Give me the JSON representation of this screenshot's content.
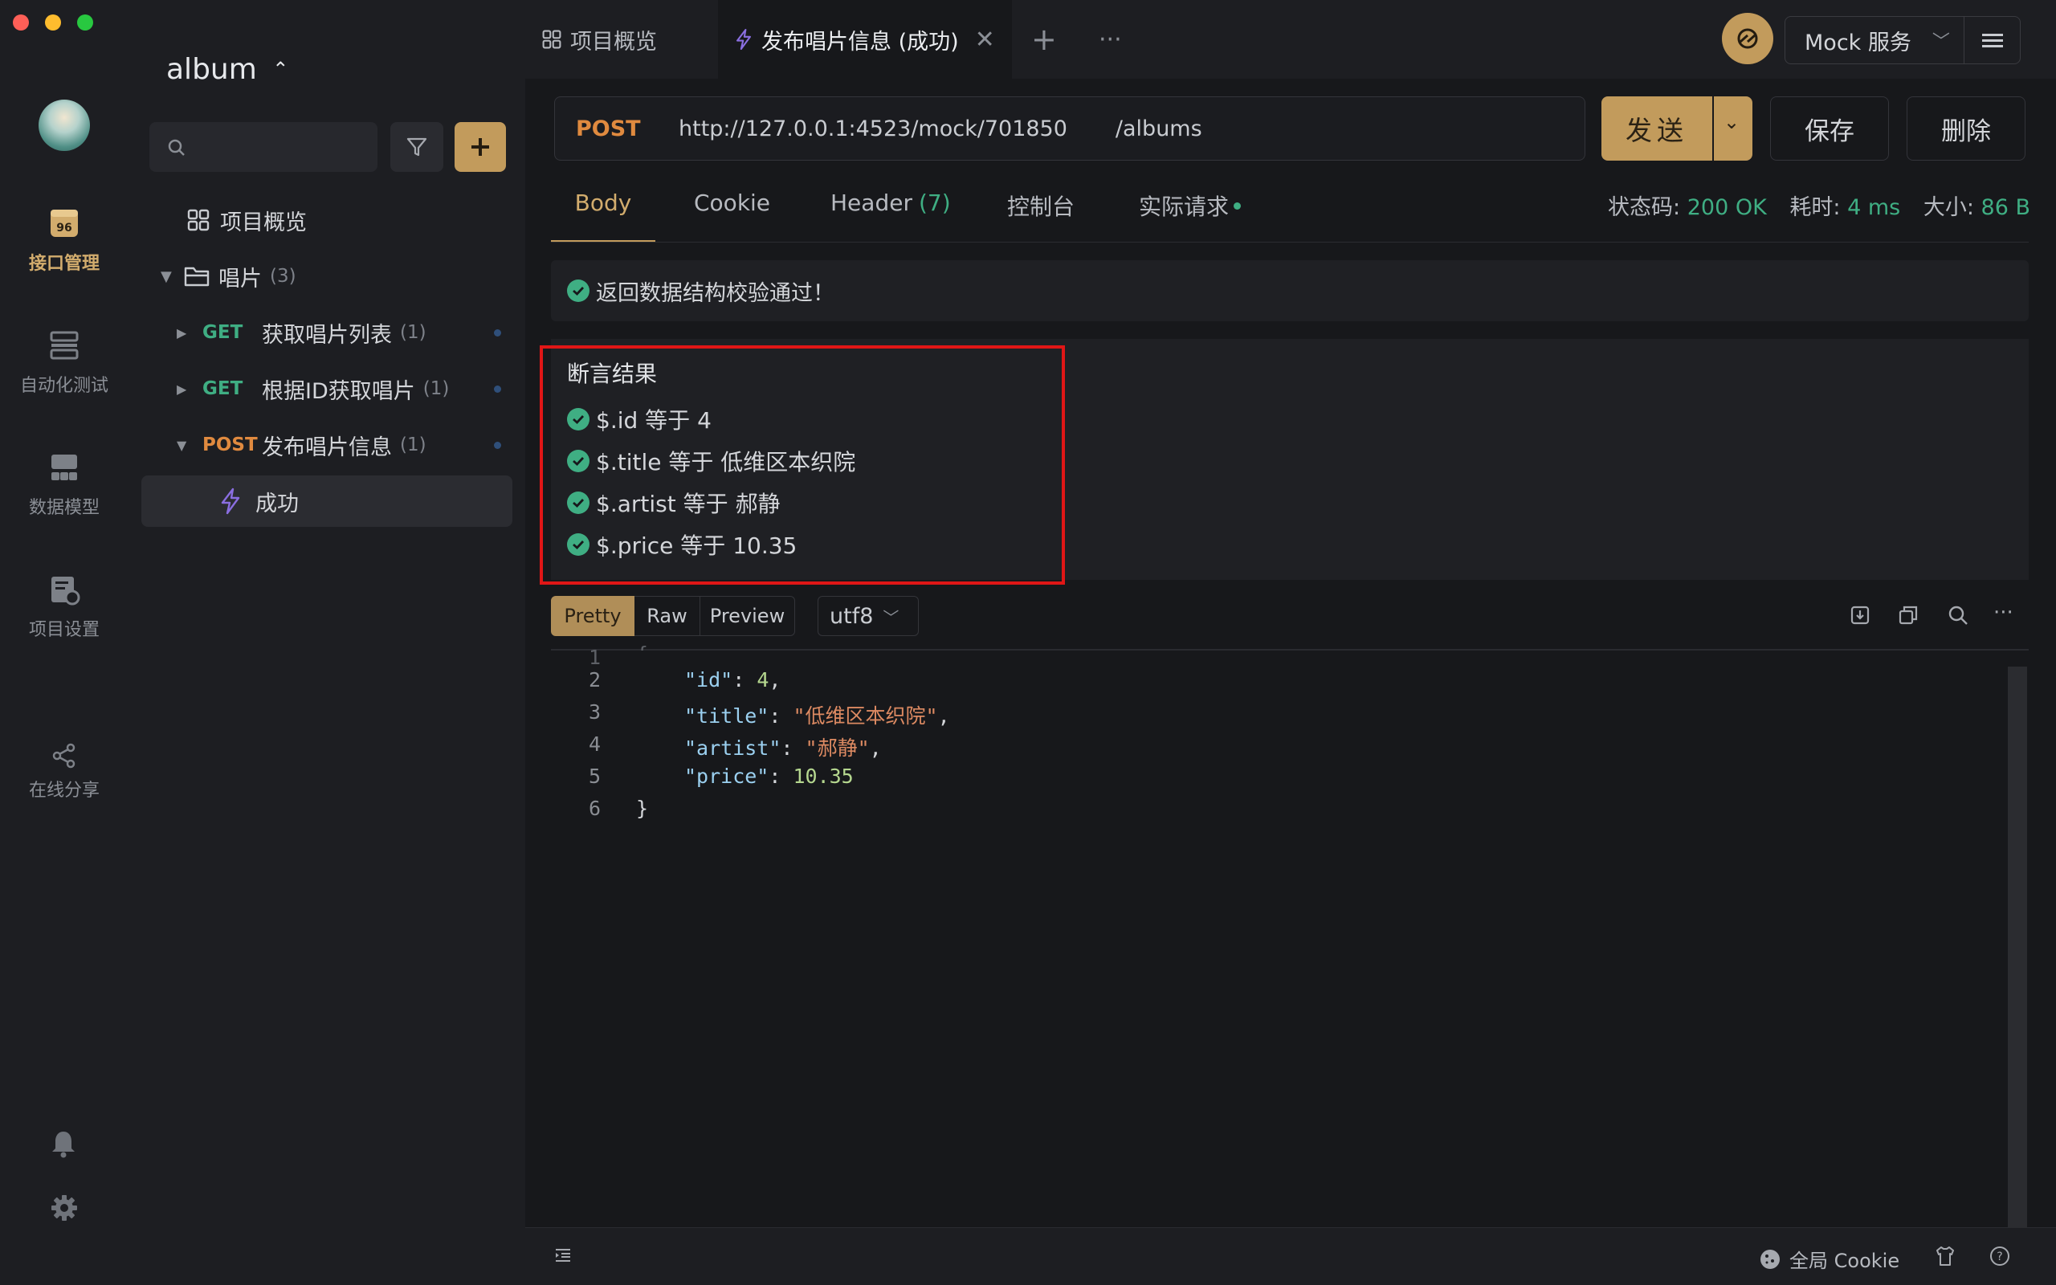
{
  "window": {
    "traffic_colors": [
      "#fe5f57",
      "#febc2e",
      "#28c840"
    ]
  },
  "rail": {
    "items": [
      {
        "label": "接口管理",
        "icon": "api-management-icon",
        "active": true
      },
      {
        "label": "自动化测试",
        "icon": "automation-test-icon",
        "active": false
      },
      {
        "label": "数据模型",
        "icon": "data-model-icon",
        "active": false
      },
      {
        "label": "项目设置",
        "icon": "project-settings-icon",
        "active": false
      },
      {
        "label": "在线分享",
        "icon": "share-icon",
        "active": false
      }
    ],
    "bottom_icons": [
      "bell-icon",
      "gear-icon"
    ]
  },
  "sidebar": {
    "project_name": "album",
    "search_placeholder": "",
    "tree": {
      "overview": "项目概览",
      "folder": {
        "name": "唱片",
        "count": "(3)"
      },
      "endpoints": [
        {
          "method": "GET",
          "name": "获取唱片列表",
          "count": "(1)"
        },
        {
          "method": "GET",
          "name": "根据ID获取唱片",
          "count": "(1)"
        },
        {
          "method": "POST",
          "name": "发布唱片信息",
          "count": "(1)"
        }
      ],
      "case": "成功"
    }
  },
  "tabs": {
    "overview": "项目概览",
    "active": "发布唱片信息 (成功)"
  },
  "topbar": {
    "mock_service": "Mock 服务"
  },
  "request": {
    "method": "POST",
    "base_url": "http://127.0.0.1:4523/mock/701850",
    "path": "/albums",
    "send_label": "发送",
    "save_label": "保存",
    "delete_label": "删除"
  },
  "response": {
    "tabs": {
      "body": "Body",
      "cookie": "Cookie",
      "header": "Header",
      "header_count": "(7)",
      "console": "控制台",
      "actual": "实际请求"
    },
    "status": {
      "code_label": "状态码:",
      "code_value": "200 OK",
      "time_label": "耗时:",
      "time_value": "4 ms",
      "size_label": "大小:",
      "size_value": "86 B"
    },
    "schema_ok": "返回数据结构校验通过！",
    "assertions": {
      "title": "断言结果",
      "items": [
        "$.id 等于 4",
        "$.title 等于 低维区本织院",
        "$.artist 等于 郝静",
        "$.price 等于 10.35"
      ]
    },
    "view_modes": {
      "pretty": "Pretty",
      "raw": "Raw",
      "preview": "Preview"
    },
    "encoding": "utf8",
    "code": {
      "line_numbers": [
        "1",
        "2",
        "3",
        "4",
        "5",
        "6"
      ],
      "id_key": "\"id\"",
      "id_val": "4",
      "title_key": "\"title\"",
      "title_val": "\"低维区本织院\"",
      "artist_key": "\"artist\"",
      "artist_val": "\"郝静\"",
      "price_key": "\"price\"",
      "price_val": "10.35",
      "open_brace": "{",
      "close_brace": "}"
    }
  },
  "footer": {
    "cookie_label": "全局 Cookie"
  },
  "colors": {
    "accent": "#c29b5c",
    "get": "#3fae83",
    "post": "#e08a3f",
    "success": "#3fae83",
    "highlight_frame": "#e01616"
  }
}
